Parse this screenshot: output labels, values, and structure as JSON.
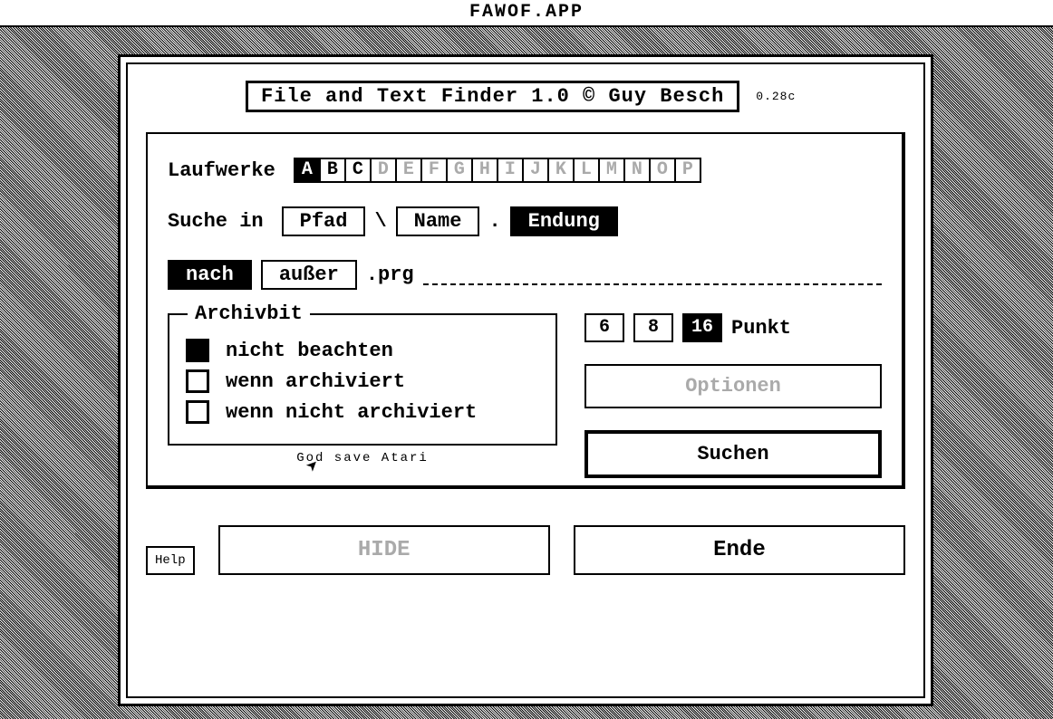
{
  "menubar": {
    "title": "FAWOF.APP"
  },
  "window": {
    "title": "File and Text Finder 1.0  © Guy Besch",
    "version": "0.28c"
  },
  "drives": {
    "label": "Laufwerke",
    "items": [
      {
        "letter": "A",
        "state": "sel"
      },
      {
        "letter": "B",
        "state": "on"
      },
      {
        "letter": "C",
        "state": "on"
      },
      {
        "letter": "D",
        "state": "dim"
      },
      {
        "letter": "E",
        "state": "dim"
      },
      {
        "letter": "F",
        "state": "dim"
      },
      {
        "letter": "G",
        "state": "dim"
      },
      {
        "letter": "H",
        "state": "dim"
      },
      {
        "letter": "I",
        "state": "dim"
      },
      {
        "letter": "J",
        "state": "dim"
      },
      {
        "letter": "K",
        "state": "dim"
      },
      {
        "letter": "L",
        "state": "dim"
      },
      {
        "letter": "M",
        "state": "dim"
      },
      {
        "letter": "N",
        "state": "dim"
      },
      {
        "letter": "O",
        "state": "dim"
      },
      {
        "letter": "P",
        "state": "dim"
      }
    ]
  },
  "search_in": {
    "label": "Suche in",
    "pfad": "Pfad",
    "name": "Name",
    "endung": "Endung",
    "backslash": "\\",
    "dot": "."
  },
  "mode": {
    "nach": "nach",
    "ausser": "außer",
    "pattern": ".prg"
  },
  "archive": {
    "legend": "Archivbit",
    "opt1": "nicht beachten",
    "opt2": "wenn archiviert",
    "opt3": "wenn nicht archiviert"
  },
  "points": {
    "p6": "6",
    "p8": "8",
    "p16": "16",
    "label": "Punkt"
  },
  "buttons": {
    "optionen": "Optionen",
    "suchen": "Suchen",
    "help": "Help",
    "hide": "HIDE",
    "ende": "Ende"
  },
  "credit": "God save Atari"
}
